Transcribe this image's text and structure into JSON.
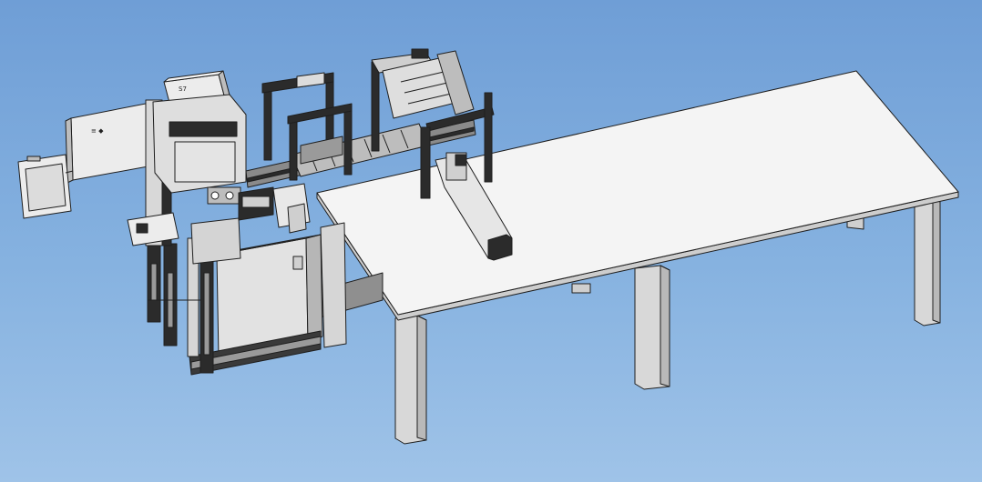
{
  "colors": {
    "sky_top": "#6f9ed6",
    "sky_bottom": "#9fc3e8",
    "part_light": "#ececec",
    "part_mid": "#cfcfcf",
    "part_dark": "#9a9a9a",
    "frame_dark": "#2b2b2b",
    "table_top": "#f4f4f4",
    "outline": "#1f1f1f"
  },
  "labels": {
    "box_mark": "S7",
    "panel_mark": "≡ ◆"
  }
}
